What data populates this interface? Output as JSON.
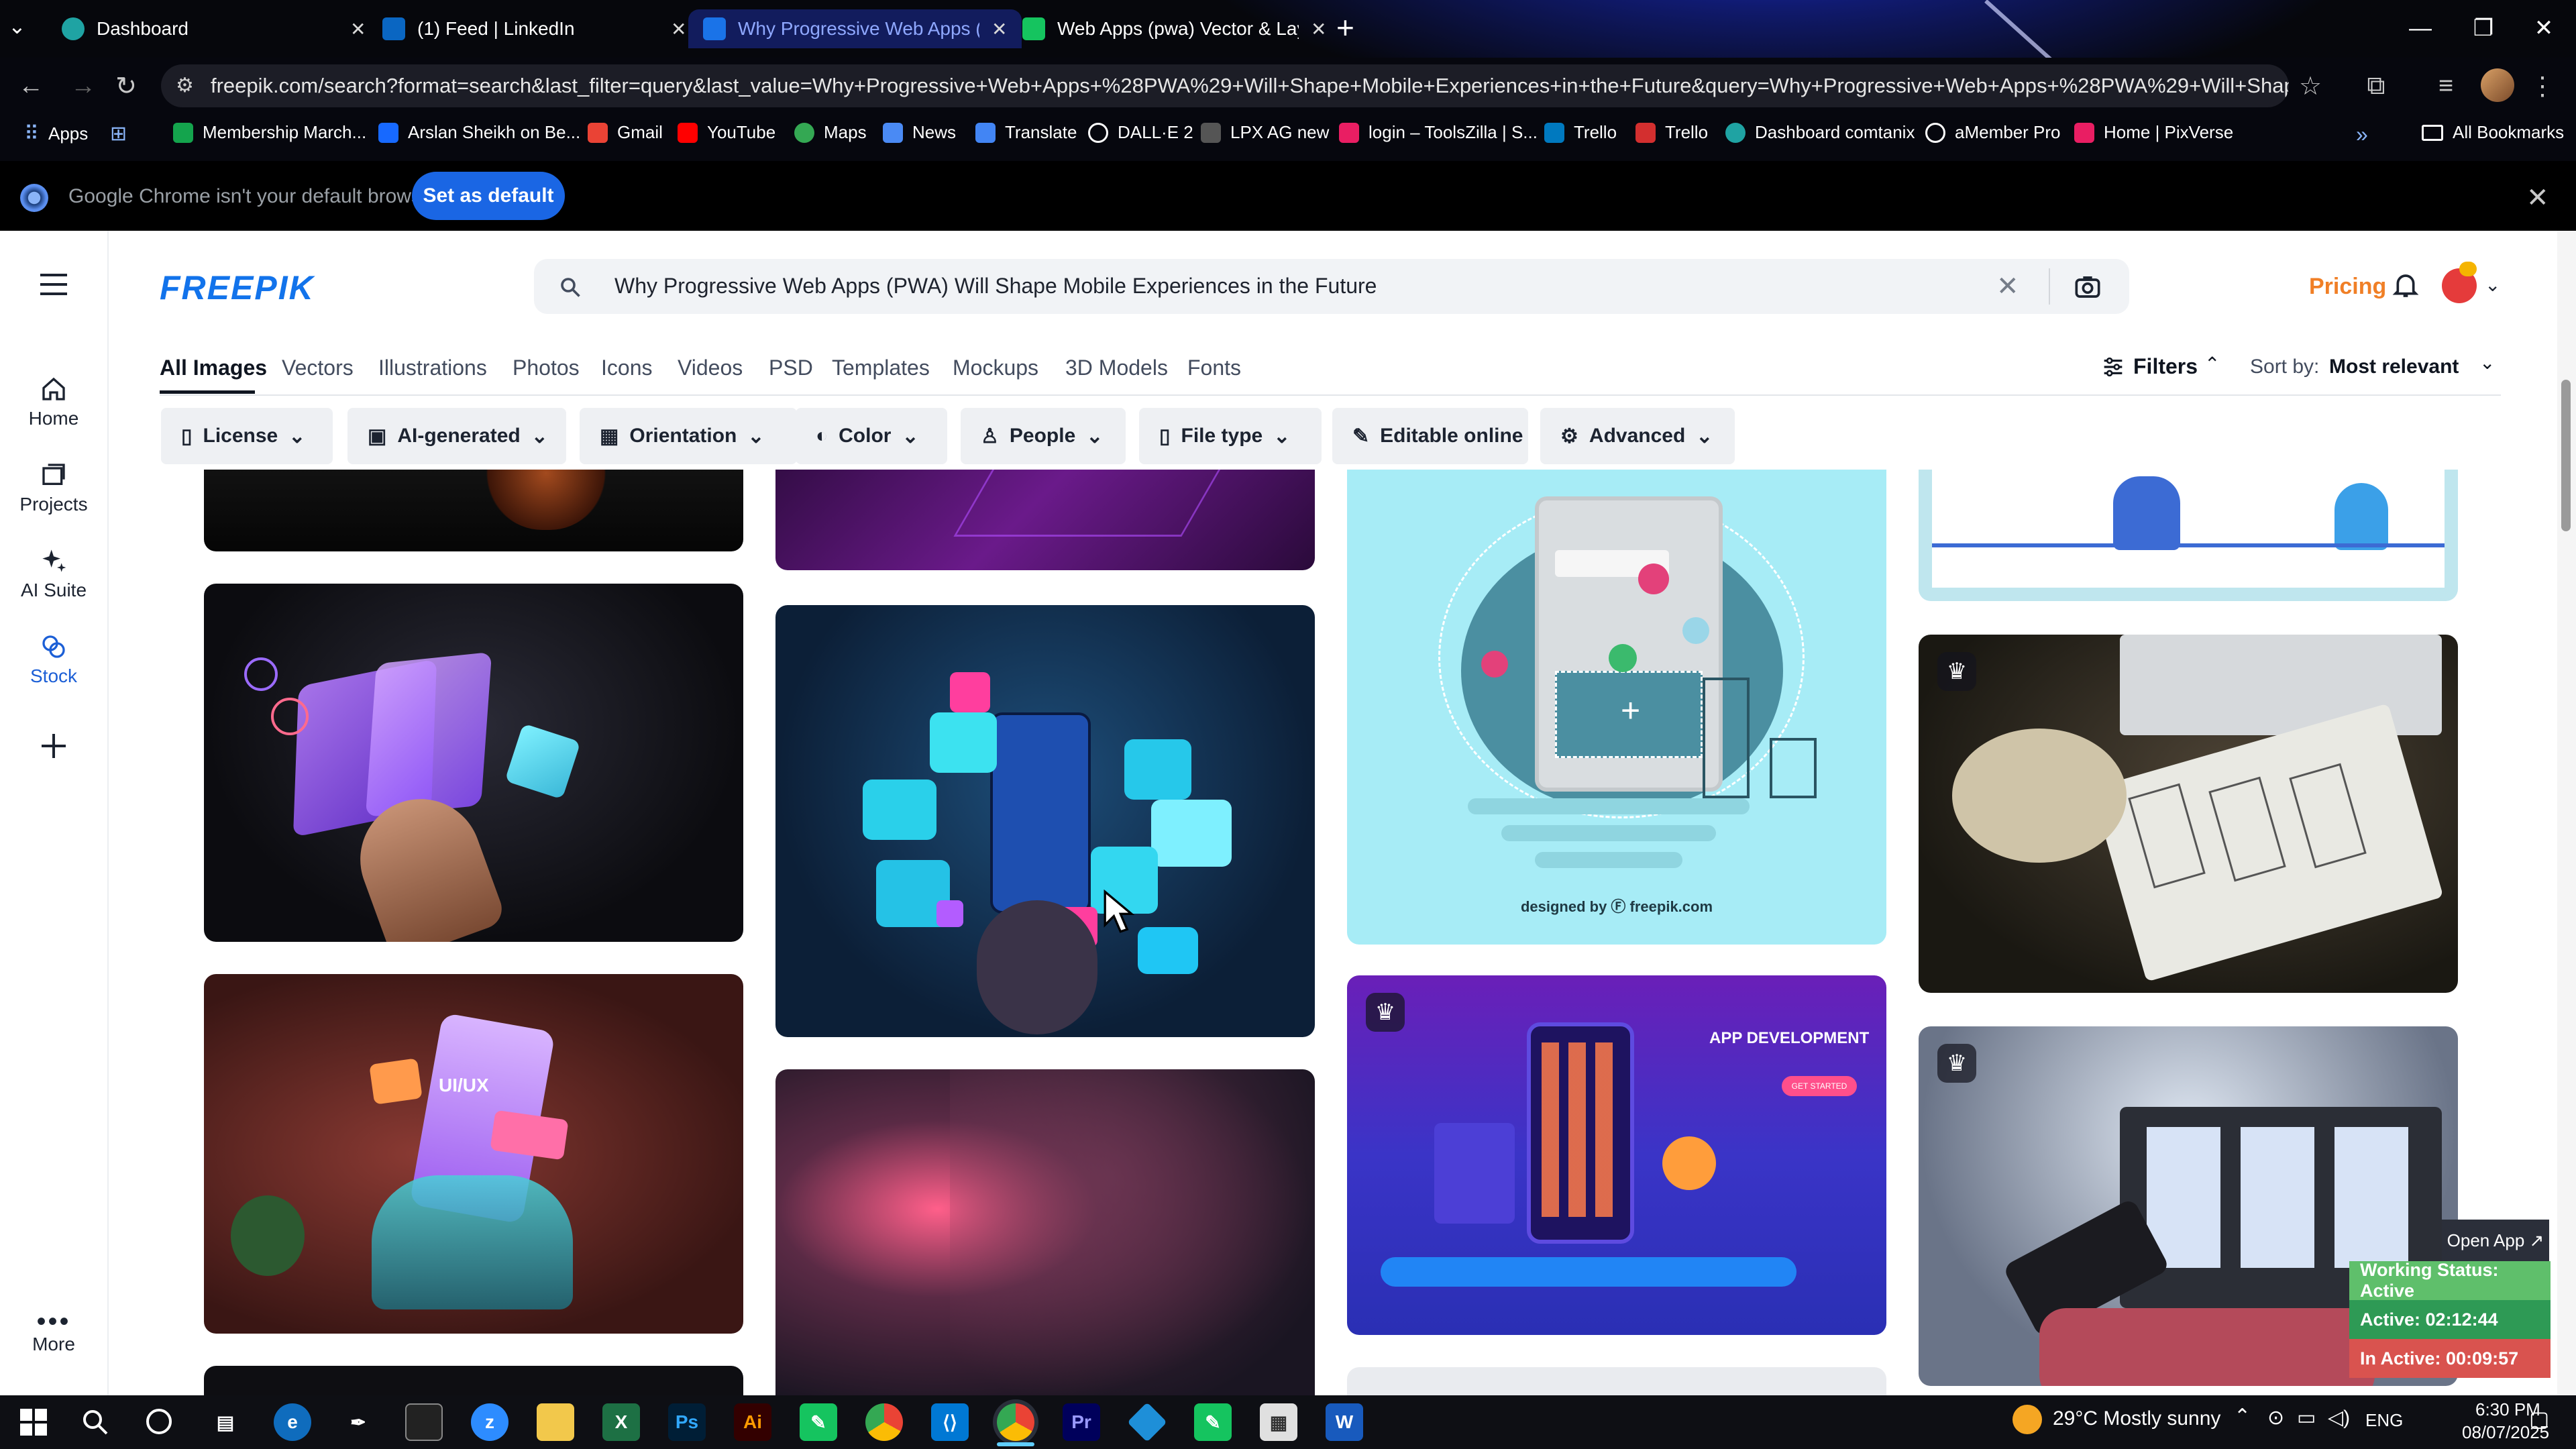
{
  "browser": {
    "tabs": [
      {
        "label": "Dashboard",
        "color": "#1fa3a3"
      },
      {
        "label": "(1) Feed | LinkedIn",
        "color": "#0a66c2"
      },
      {
        "label": "Why Progressive Web Apps (PW",
        "color": "#1a73e8"
      },
      {
        "label": "Web Apps (pwa) Vector & Laye",
        "color": "#15c45f"
      }
    ],
    "url": "freepik.com/search?format=search&last_filter=query&last_value=Why+Progressive+Web+Apps+%28PWA%29+Will+Shape+Mobile+Experiences+in+the+Future&query=Why+Progressive+Web+Apps+%28PWA%29+Will+Shape+Mobile+Experien...",
    "bookmarks": [
      {
        "label": "Apps",
        "color": "#4285f4"
      },
      {
        "label": "Membership March...",
        "color": "#14a44d"
      },
      {
        "label": "Arslan Sheikh on Be...",
        "color": "#1769ff"
      },
      {
        "label": "Gmail",
        "color": "#ea4335"
      },
      {
        "label": "YouTube",
        "color": "#ff0000"
      },
      {
        "label": "Maps",
        "color": "#34a853"
      },
      {
        "label": "News",
        "color": "#4a8af4"
      },
      {
        "label": "Translate",
        "color": "#4285f4"
      },
      {
        "label": "DALL·E 2",
        "color": "#ffffff"
      },
      {
        "label": "LPX AG new",
        "color": "#555555"
      },
      {
        "label": "login – ToolsZilla | S...",
        "color": "#e91e63"
      },
      {
        "label": "Trello",
        "color": "#0079bf"
      },
      {
        "label": "Trello",
        "color": "#d32f2f"
      },
      {
        "label": "Dashboard comtanix",
        "color": "#1fa3a3"
      },
      {
        "label": "aMember Pro",
        "color": "#ffffff"
      },
      {
        "label": "Home | PixVerse",
        "color": "#e91e63"
      }
    ],
    "all_bookmarks": "All Bookmarks",
    "infobar_text": "Google Chrome isn't your default browser",
    "set_default": "Set as default"
  },
  "site": {
    "logo": "FREEPIK",
    "search_value": "Why Progressive Web Apps (PWA) Will Shape Mobile Experiences in the Future",
    "pricing": "Pricing",
    "nav": [
      {
        "label": "Home",
        "icon": "home-icon"
      },
      {
        "label": "Projects",
        "icon": "folder-icon"
      },
      {
        "label": "AI Suite",
        "icon": "sparkle-icon"
      },
      {
        "label": "Stock",
        "icon": "stock-icon"
      }
    ],
    "more": "More",
    "categories": [
      "All Images",
      "Vectors",
      "Illustrations",
      "Photos",
      "Icons",
      "Videos",
      "PSD",
      "Templates",
      "Mockups",
      "3D Models",
      "Fonts"
    ],
    "filters_label": "Filters",
    "sort_label": "Sort by:",
    "sort_value": "Most relevant",
    "chips": [
      "License",
      "AI-generated",
      "Orientation",
      "Color",
      "People",
      "File type",
      "Editable online",
      "Advanced"
    ]
  },
  "images": {
    "app_development_heading": "APP DEVELOPMENT",
    "get_started": "GET STARTED",
    "uiux": "UI/UX",
    "credit": "designed by Ⓕ freepik.com"
  },
  "widget": {
    "open_app": "Open App ↗",
    "working_status": "Working Status: Active",
    "active": "Active: 02:12:44",
    "inactive": "In Active: 00:09:57",
    "colors": {
      "working": "#5fbf6b",
      "active": "#2e9a55",
      "inactive": "#d9534f"
    }
  },
  "taskbar": {
    "weather": "29°C  Mostly sunny",
    "lang": "ENG",
    "time": "6:30 PM",
    "date": "08/07/2025"
  }
}
